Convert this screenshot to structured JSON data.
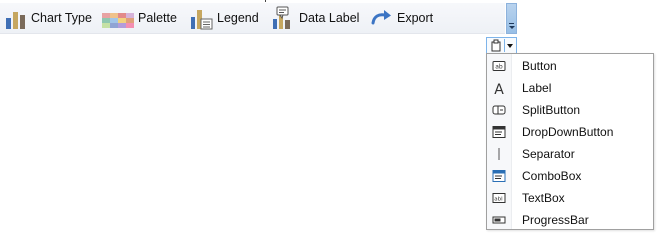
{
  "toolbar": {
    "items": [
      {
        "label": "Chart Type",
        "icon": "chart-type-icon"
      },
      {
        "label": "Palette",
        "icon": "palette-icon"
      },
      {
        "label": "Legend",
        "icon": "legend-icon"
      },
      {
        "label": "Data Label",
        "icon": "data-label-icon"
      },
      {
        "label": "Export",
        "icon": "export-arrow-icon"
      }
    ],
    "overflow_icon": "toolbar-overflow-chevron-icon"
  },
  "add_item_button": {
    "icon": "add-toolstrip-item-icon",
    "dropdown_icon": "chevron-down-icon"
  },
  "add_item_menu": {
    "items": [
      {
        "label": "Button",
        "icon": "button-icon"
      },
      {
        "label": "Label",
        "icon": "label-icon"
      },
      {
        "label": "SplitButton",
        "icon": "split-button-icon"
      },
      {
        "label": "DropDownButton",
        "icon": "dropdown-button-icon"
      },
      {
        "label": "Separator",
        "icon": "separator-icon"
      },
      {
        "label": "ComboBox",
        "icon": "combobox-icon"
      },
      {
        "label": "TextBox",
        "icon": "textbox-icon"
      },
      {
        "label": "ProgressBar",
        "icon": "progressbar-icon"
      }
    ]
  },
  "colors": {
    "toolbar_bg": "#f2f4f8",
    "highlight_border": "#7eb4ea",
    "overflow_bg": "#a9c9eb",
    "bar_blue": "#3f6fb5",
    "bar_gold": "#c6a760",
    "bar_brown": "#7a6a5a",
    "export_blue": "#3c75c4"
  }
}
